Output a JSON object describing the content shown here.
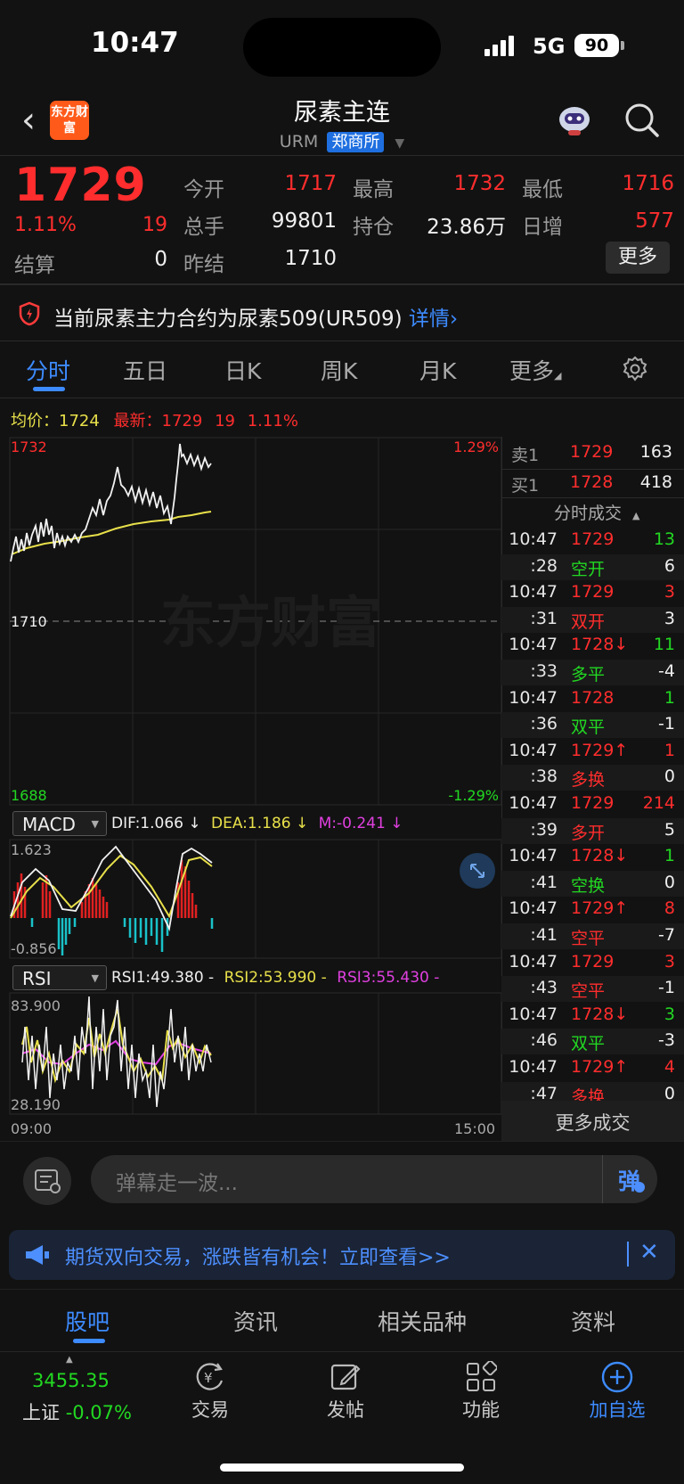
{
  "status": {
    "time": "10:47",
    "network": "5G",
    "battery": "90"
  },
  "header": {
    "logo": "东方财富",
    "title": "尿素主连",
    "code": "URM",
    "exchange": "郑商所"
  },
  "quote": {
    "price": "1729",
    "change_pct": "1.11%",
    "change": "19",
    "settle_label": "结算",
    "settle": "0",
    "open_label": "今开",
    "open": "1717",
    "high_label": "最高",
    "high": "1732",
    "low_label": "最低",
    "low": "1716",
    "volume_label": "总手",
    "volume": "99801",
    "oi_label": "持仓",
    "oi": "23.86万",
    "oi_add_label": "日增",
    "oi_add": "577",
    "prev_settle_label": "昨结",
    "prev_settle": "1710",
    "more": "更多"
  },
  "notice": {
    "text": "当前尿素主力合约为尿素509(UR509)",
    "link": "详情"
  },
  "tabs": [
    "分时",
    "五日",
    "日K",
    "周K",
    "月K",
    "更多"
  ],
  "info_bar": {
    "avg_label": "均价：",
    "avg": "1724",
    "latest_label": "最新：",
    "latest": "1729",
    "chg": "19",
    "pct": "1.11%"
  },
  "chart": {
    "ymax": "1732",
    "ymin": "1688",
    "ymid": "1710",
    "pmax": "1.29%",
    "pmin": "-1.29%",
    "watermark": "东方财富",
    "time_start": "09:00",
    "time_end": "15:00"
  },
  "macd": {
    "name": "MACD",
    "dif": "DIF:1.066 ↓",
    "dea": "DEA:1.186 ↓",
    "m": "M:-0.241 ↓",
    "max": "1.623",
    "min": "-0.856"
  },
  "rsi": {
    "name": "RSI",
    "rsi1": "RSI1:49.380 -",
    "rsi2": "RSI2:53.990 -",
    "rsi3": "RSI3:55.430 -",
    "max": "83.900",
    "min": "28.190"
  },
  "orderbook": {
    "sell_label": "卖1",
    "sell_price": "1729",
    "sell_vol": "163",
    "buy_label": "买1",
    "buy_price": "1728",
    "buy_vol": "418"
  },
  "trades_title": "分时成交",
  "trades": [
    {
      "t": "10:47",
      "p": "1729",
      "pc": "red",
      "v": "13",
      "vc": "green"
    },
    {
      "t": ":28",
      "p": "空开",
      "pc": "green",
      "v": "6",
      "vc": "white"
    },
    {
      "t": "10:47",
      "p": "1729",
      "pc": "red",
      "v": "3",
      "vc": "red"
    },
    {
      "t": ":31",
      "p": "双开",
      "pc": "red",
      "v": "3",
      "vc": "white"
    },
    {
      "t": "10:47",
      "p": "1728↓",
      "pc": "red",
      "v": "11",
      "vc": "green"
    },
    {
      "t": ":33",
      "p": "多平",
      "pc": "green",
      "v": "-4",
      "vc": "white"
    },
    {
      "t": "10:47",
      "p": "1728",
      "pc": "red",
      "v": "1",
      "vc": "green"
    },
    {
      "t": ":36",
      "p": "双平",
      "pc": "green",
      "v": "-1",
      "vc": "white"
    },
    {
      "t": "10:47",
      "p": "1729↑",
      "pc": "red",
      "v": "1",
      "vc": "red"
    },
    {
      "t": ":38",
      "p": "多换",
      "pc": "red",
      "v": "0",
      "vc": "white"
    },
    {
      "t": "10:47",
      "p": "1729",
      "pc": "red",
      "v": "214",
      "vc": "red"
    },
    {
      "t": ":39",
      "p": "多开",
      "pc": "red",
      "v": "5",
      "vc": "white"
    },
    {
      "t": "10:47",
      "p": "1728↓",
      "pc": "red",
      "v": "1",
      "vc": "green"
    },
    {
      "t": ":41",
      "p": "空换",
      "pc": "green",
      "v": "0",
      "vc": "white"
    },
    {
      "t": "10:47",
      "p": "1729↑",
      "pc": "red",
      "v": "8",
      "vc": "red"
    },
    {
      "t": ":41",
      "p": "空平",
      "pc": "red",
      "v": "-7",
      "vc": "white"
    },
    {
      "t": "10:47",
      "p": "1729",
      "pc": "red",
      "v": "3",
      "vc": "red"
    },
    {
      "t": ":43",
      "p": "空平",
      "pc": "red",
      "v": "-1",
      "vc": "white"
    },
    {
      "t": "10:47",
      "p": "1728↓",
      "pc": "red",
      "v": "3",
      "vc": "green"
    },
    {
      "t": ":46",
      "p": "双平",
      "pc": "green",
      "v": "-3",
      "vc": "white"
    },
    {
      "t": "10:47",
      "p": "1729↑",
      "pc": "red",
      "v": "4",
      "vc": "red"
    },
    {
      "t": ":47",
      "p": "多换",
      "pc": "red",
      "v": "0",
      "vc": "white"
    }
  ],
  "more_trades": "更多成交",
  "danmaku": {
    "placeholder": "弹幕走一波...",
    "btn": "弹"
  },
  "promo": {
    "text": "期货双向交易，涨跌皆有机会！立即查看>>"
  },
  "bottom_tabs": [
    "股吧",
    "资讯",
    "相关品种",
    "资料"
  ],
  "nav": {
    "index_value": "3455.35",
    "index_name": "上证",
    "index_pct": "-0.07%",
    "trade": "交易",
    "post": "发帖",
    "func": "功能",
    "add": "加自选"
  },
  "colors": {
    "up": "#ff2d2d",
    "down": "#22d822",
    "accent": "#3d8bff",
    "avg_line": "#e8e04a"
  }
}
